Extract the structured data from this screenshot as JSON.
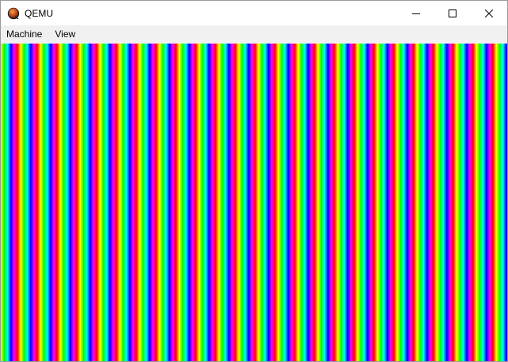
{
  "window": {
    "title": "QEMU",
    "icon": "qemu-logo-icon",
    "controls": {
      "minimize_icon": "minimize-icon",
      "maximize_icon": "maximize-icon",
      "close_icon": "close-icon"
    }
  },
  "menubar": {
    "items": [
      {
        "label": "Machine"
      },
      {
        "label": "View"
      }
    ]
  },
  "display": {
    "pattern": "vertical rainbow hue stripes",
    "colors": [
      "#ff0000",
      "#ffff00",
      "#00ff00",
      "#00ffff",
      "#0000ff",
      "#ff00ff",
      "#ff0000"
    ]
  }
}
